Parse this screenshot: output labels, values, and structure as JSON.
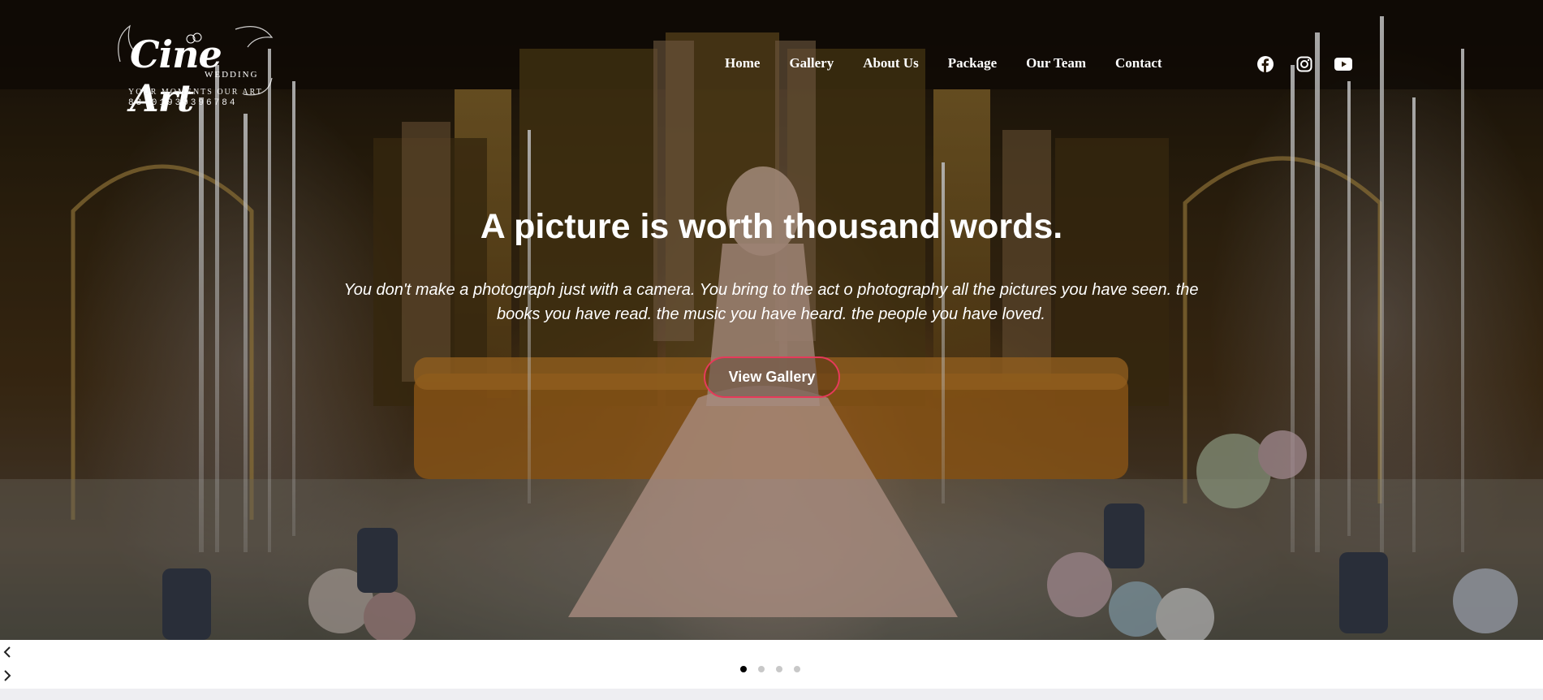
{
  "brand": {
    "logo_script": "Cine Art",
    "logo_sub": "WEDDING",
    "tagline": "YOUR MOMENTS OUR ART",
    "phone": "88 01939396784"
  },
  "nav": {
    "items": [
      {
        "label": "Home"
      },
      {
        "label": "Gallery"
      },
      {
        "label": "About Us"
      },
      {
        "label": "Package"
      },
      {
        "label": "Our Team"
      },
      {
        "label": "Contact"
      }
    ]
  },
  "social": {
    "icons": [
      "facebook-icon",
      "instagram-icon",
      "youtube-icon"
    ]
  },
  "hero": {
    "title": "A picture is worth thousand words.",
    "text": "You don't make a photograph just with a camera. You bring to the act o photography all the pictures you have seen. the books you have read. the music you have heard. the people you have loved.",
    "cta_label": "View Gallery",
    "accent_color": "#e63a5a"
  },
  "slider": {
    "prev_icon": "chevron-left-icon",
    "next_icon": "chevron-right-icon",
    "total_slides": 4,
    "active_slide": 1
  }
}
